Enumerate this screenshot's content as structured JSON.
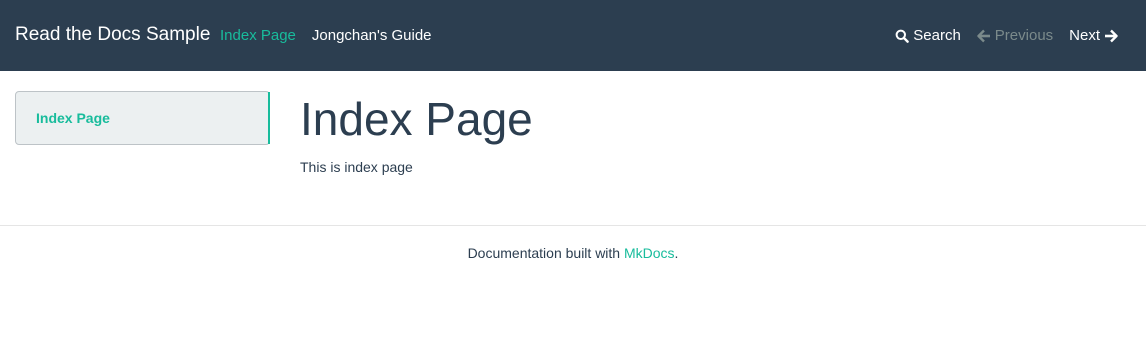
{
  "navbar": {
    "brand": "Read the Docs Sample",
    "links": [
      {
        "label": "Index Page"
      },
      {
        "label": "Jongchan's Guide"
      }
    ],
    "actions": {
      "search": "Search",
      "previous": "Previous",
      "next": "Next"
    },
    "icons": {
      "search": "search-icon",
      "previous": "arrow-left-icon",
      "next": "arrow-right-icon"
    }
  },
  "sidebar": {
    "items": [
      {
        "label": "Index Page"
      }
    ]
  },
  "main": {
    "title": "Index Page",
    "body": "This is index page"
  },
  "footer": {
    "prefix": "Documentation built with ",
    "link": "MkDocs",
    "suffix": "."
  },
  "colors": {
    "navbar_bg": "#2c3e50",
    "accent": "#18bc9c",
    "disabled": "#7b8a8b",
    "sidebar_bg": "#ecf0f1"
  }
}
